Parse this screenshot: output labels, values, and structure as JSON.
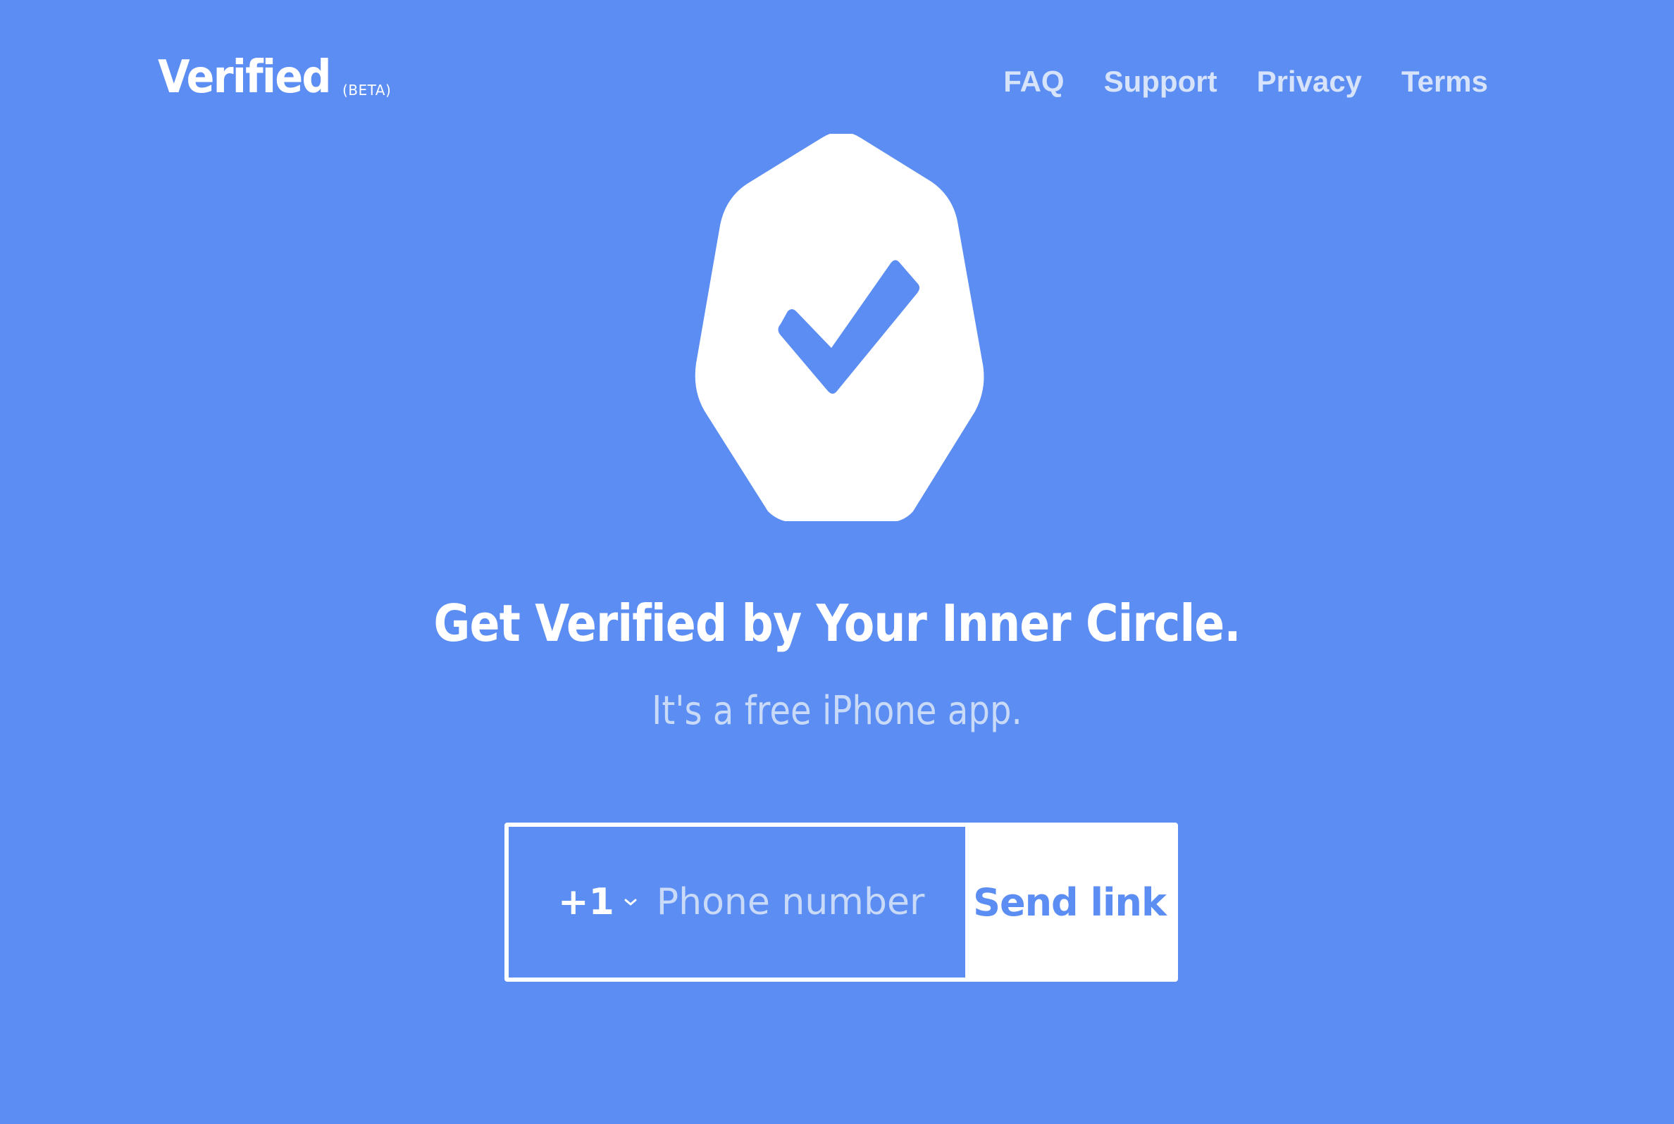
{
  "header": {
    "brand": "Verified",
    "brand_tag": "(BETA)",
    "nav": [
      {
        "label": "FAQ"
      },
      {
        "label": "Support"
      },
      {
        "label": "Privacy"
      },
      {
        "label": "Terms"
      }
    ]
  },
  "hero": {
    "icon": "verified-shield-check-icon",
    "headline": "Get Verified by Your Inner Circle.",
    "subline": "It's a free iPhone app."
  },
  "signup": {
    "country_code": "+1",
    "phone_placeholder": "Phone number",
    "phone_value": "",
    "send_label": "Send link"
  },
  "colors": {
    "background": "#5b8df2",
    "foreground": "#ffffff",
    "muted_text": "#c9daf8",
    "nav_text": "#d6e3fb"
  }
}
